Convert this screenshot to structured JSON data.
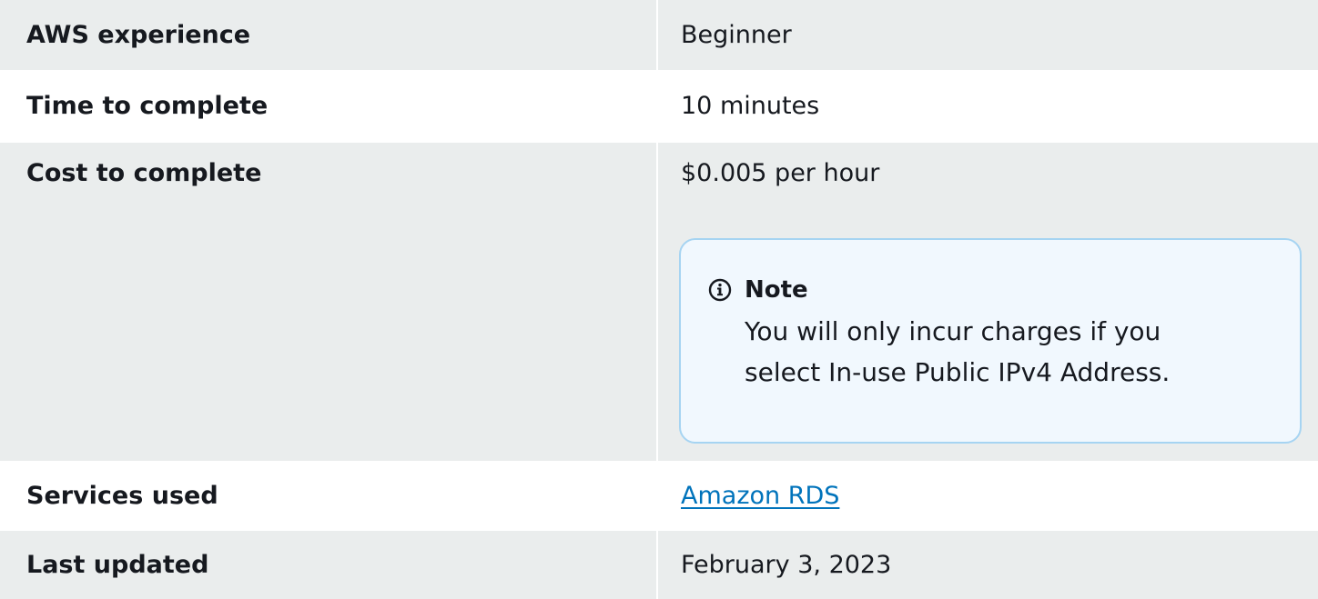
{
  "rows": [
    {
      "label": "AWS experience",
      "value": "Beginner"
    },
    {
      "label": "Time to complete",
      "value": "10 minutes"
    },
    {
      "label": "Cost to complete",
      "value": "$0.005 per hour"
    },
    {
      "label": "Services used",
      "value": "Amazon RDS"
    },
    {
      "label": "Last updated",
      "value": "February 3, 2023"
    }
  ],
  "note": {
    "icon": "info-icon",
    "title": "Note",
    "body": "You will only incur charges if you select In-use Public IPv4 Address."
  },
  "colors": {
    "shaded_row": "#eaeded",
    "link": "#0073bb",
    "note_background": "#f1f8fe",
    "note_border": "#a6d4f2",
    "text": "#16191f"
  }
}
